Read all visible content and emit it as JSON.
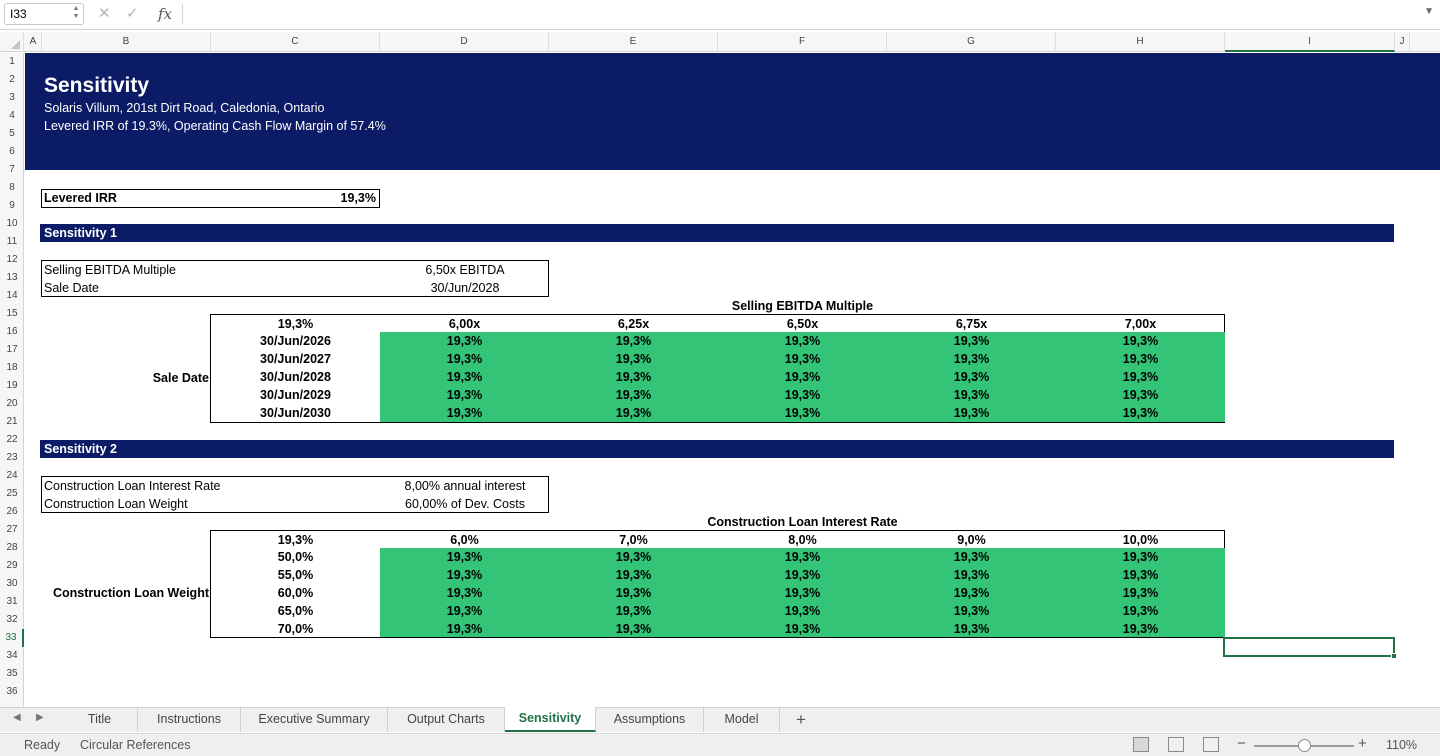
{
  "formula_bar": {
    "name_box": "I33",
    "cancel_icon": "✕",
    "enter_icon": "✓",
    "fx_label": "fx",
    "formula": ""
  },
  "columns": [
    "A",
    "B",
    "C",
    "D",
    "E",
    "F",
    "G",
    "H",
    "I",
    "J"
  ],
  "active_column": "I",
  "rows": [
    "1",
    "2",
    "3",
    "4",
    "5",
    "6",
    "7",
    "8",
    "9",
    "10",
    "11",
    "12",
    "13",
    "14",
    "15",
    "16",
    "17",
    "18",
    "19",
    "20",
    "21",
    "22",
    "23",
    "24",
    "25",
    "26",
    "27",
    "28",
    "29",
    "30",
    "31",
    "32",
    "33",
    "34",
    "35",
    "36"
  ],
  "active_row": "33",
  "banner": {
    "title": "Sensitivity",
    "address": "Solaris Villum, 201st Dirt Road, Caledonia, Ontario",
    "subtitle": "Levered IRR of 19.3%, Operating Cash Flow Margin of 57.4%",
    "color": "#0c1b66"
  },
  "levered_irr": {
    "label": "Levered IRR",
    "value": "19,3%"
  },
  "sensitivity1": {
    "header": "Sensitivity 1",
    "inputs": [
      {
        "label": "Selling EBITDA Multiple",
        "value": "6,50x EBITDA"
      },
      {
        "label": "Sale Date",
        "value": "30/Jun/2028"
      }
    ],
    "col_title": "Selling EBITDA Multiple",
    "row_title": "Sale Date",
    "corner": "19,3%",
    "col_values": [
      "6,00x",
      "6,25x",
      "6,50x",
      "6,75x",
      "7,00x"
    ],
    "row_values": [
      "30/Jun/2026",
      "30/Jun/2027",
      "30/Jun/2028",
      "30/Jun/2029",
      "30/Jun/2030"
    ],
    "cells": [
      [
        "19,3%",
        "19,3%",
        "19,3%",
        "19,3%",
        "19,3%"
      ],
      [
        "19,3%",
        "19,3%",
        "19,3%",
        "19,3%",
        "19,3%"
      ],
      [
        "19,3%",
        "19,3%",
        "19,3%",
        "19,3%",
        "19,3%"
      ],
      [
        "19,3%",
        "19,3%",
        "19,3%",
        "19,3%",
        "19,3%"
      ],
      [
        "19,3%",
        "19,3%",
        "19,3%",
        "19,3%",
        "19,3%"
      ]
    ]
  },
  "sensitivity2": {
    "header": "Sensitivity 2",
    "inputs": [
      {
        "label": "Construction Loan Interest Rate",
        "value": "8,00% annual interest"
      },
      {
        "label": "Construction Loan Weight",
        "value": "60,00% of Dev. Costs"
      }
    ],
    "col_title": "Construction Loan Interest Rate",
    "row_title": "Construction Loan Weight",
    "corner": "19,3%",
    "col_values": [
      "6,0%",
      "7,0%",
      "8,0%",
      "9,0%",
      "10,0%"
    ],
    "row_values": [
      "50,0%",
      "55,0%",
      "60,0%",
      "65,0%",
      "70,0%"
    ],
    "cells": [
      [
        "19,3%",
        "19,3%",
        "19,3%",
        "19,3%",
        "19,3%"
      ],
      [
        "19,3%",
        "19,3%",
        "19,3%",
        "19,3%",
        "19,3%"
      ],
      [
        "19,3%",
        "19,3%",
        "19,3%",
        "19,3%",
        "19,3%"
      ],
      [
        "19,3%",
        "19,3%",
        "19,3%",
        "19,3%",
        "19,3%"
      ],
      [
        "19,3%",
        "19,3%",
        "19,3%",
        "19,3%",
        "19,3%"
      ]
    ]
  },
  "grid_fill_color": "#33c477",
  "sheet_tabs": [
    "Title",
    "Instructions",
    "Executive Summary",
    "Output Charts",
    "Sensitivity",
    "Assumptions",
    "Model"
  ],
  "active_sheet": "Sensitivity",
  "status_bar": {
    "ready": "Ready",
    "circular": "Circular References",
    "zoom": "110%"
  }
}
